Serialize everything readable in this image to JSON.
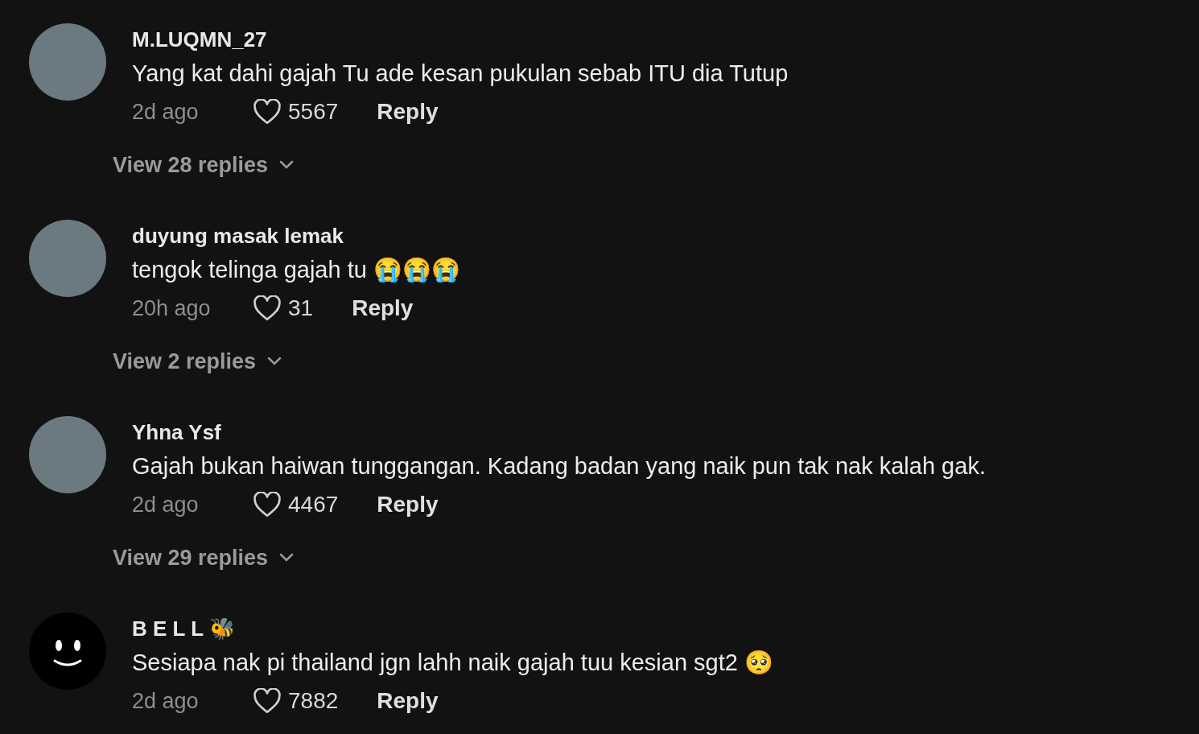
{
  "comments": [
    {
      "kind": "photo",
      "username": "M.LUQMN_27",
      "text": "Yang kat dahi gajah Tu ade kesan pukulan sebab ITU dia Tutup",
      "time": "2d ago",
      "likes": "5567",
      "reply": "Reply",
      "replies": "View 28 replies"
    },
    {
      "kind": "photo",
      "username": "duyung masak lemak",
      "text": "tengok telinga gajah tu 😭😭😭",
      "time": "20h ago",
      "likes": "31",
      "reply": "Reply",
      "replies": "View 2 replies"
    },
    {
      "kind": "photo",
      "username": "Yhna Ysf",
      "text": "Gajah bukan haiwan tunggangan. Kadang badan yang naik pun tak nak kalah gak.",
      "time": "2d ago",
      "likes": "4467",
      "reply": "Reply",
      "replies": "View 29 replies"
    },
    {
      "kind": "smiley",
      "username": "B E L L 🐝",
      "text": "Sesiapa nak pi thailand jgn lahh naik gajah tuu kesian sgt2 🥺",
      "time": "2d ago",
      "likes": "7882",
      "reply": "Reply"
    }
  ]
}
